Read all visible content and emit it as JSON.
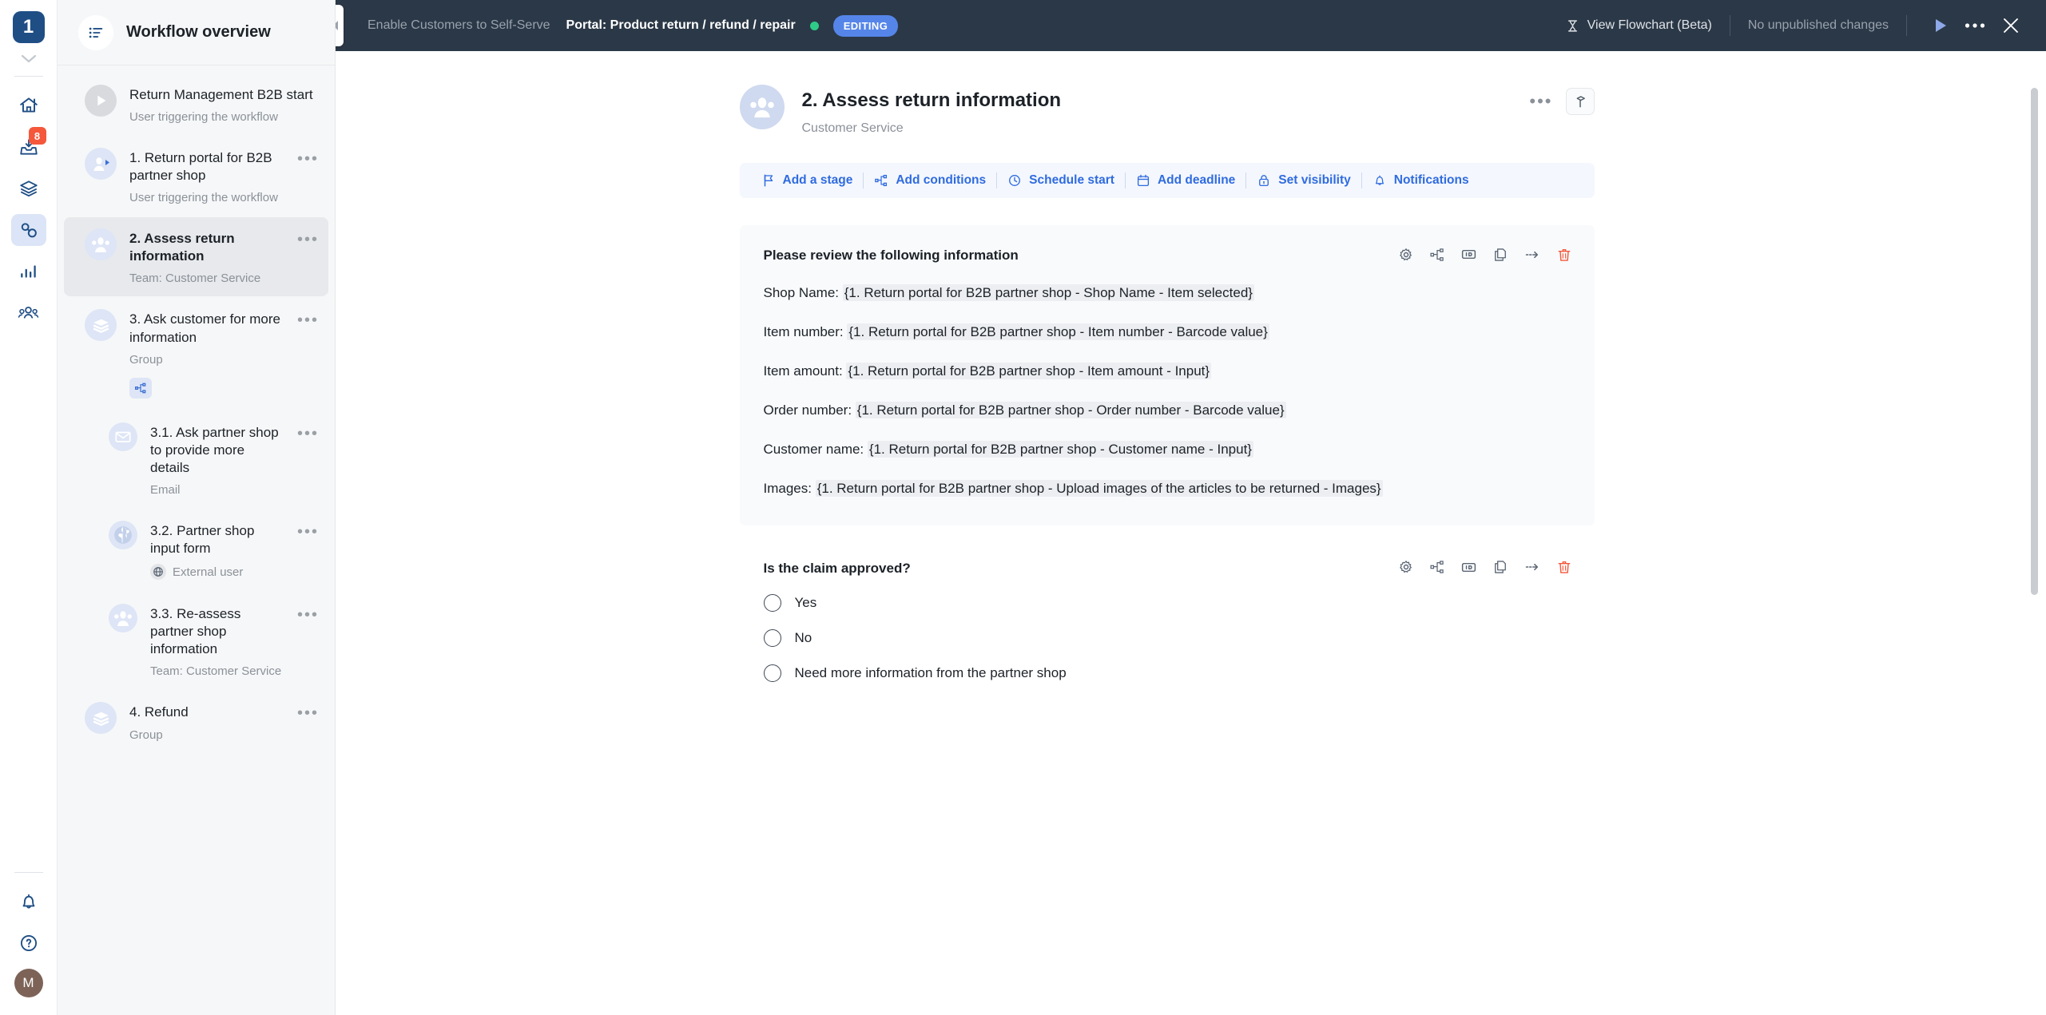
{
  "rail": {
    "logo_label": "1",
    "inbox_badge": "8",
    "avatar_initial": "M",
    "items": [
      {
        "name": "home",
        "icon": "home-icon"
      },
      {
        "name": "inbox",
        "icon": "inbox-icon",
        "badge": "8"
      },
      {
        "name": "layers",
        "icon": "layers-icon"
      },
      {
        "name": "workflows",
        "icon": "workflows-icon",
        "active": true
      },
      {
        "name": "reports",
        "icon": "bar-chart-icon"
      },
      {
        "name": "people",
        "icon": "people-icon"
      }
    ],
    "bottom_items": [
      {
        "name": "notifications",
        "icon": "bell-icon"
      },
      {
        "name": "help",
        "icon": "question-circle-icon"
      }
    ]
  },
  "sidebar": {
    "header_title": "Workflow overview",
    "header_icon": "list-icon",
    "items": [
      {
        "title": "Return Management B2B start",
        "subtitle": "User triggering the workflow",
        "icon": "play-circle-icon",
        "icon_style": "grey",
        "indent": false,
        "selected": false,
        "has_dots": false,
        "title_plain": true
      },
      {
        "title": "1. Return portal for B2B partner shop",
        "subtitle": "User triggering the workflow",
        "icon": "user-play-icon",
        "icon_style": "blue",
        "indent": false,
        "selected": false,
        "has_dots": true,
        "title_plain": true
      },
      {
        "title": "2. Assess return information",
        "subtitle": "Team: Customer Service",
        "icon": "users-icon",
        "icon_style": "blue",
        "indent": false,
        "selected": true,
        "has_dots": true,
        "title_plain": false
      },
      {
        "title": "3. Ask customer for more information",
        "subtitle": "Group",
        "icon": "layers-icon",
        "icon_style": "blue",
        "indent": false,
        "selected": false,
        "has_dots": true,
        "title_plain": true,
        "condition_chip": true
      },
      {
        "title": "3.1. Ask partner shop to provide more details",
        "subtitle": "Email",
        "icon": "envelope-icon",
        "icon_style": "blue",
        "indent": true,
        "selected": false,
        "has_dots": true,
        "title_plain": true
      },
      {
        "title": "3.2. Partner shop input form",
        "subtitle": "External user",
        "icon": "globe-icon",
        "icon_style": "blue",
        "indent": true,
        "selected": false,
        "has_dots": true,
        "title_plain": true,
        "sub_icon": "globe-small-icon"
      },
      {
        "title": "3.3. Re-assess partner shop information",
        "subtitle": "Team: Customer Service",
        "icon": "users-icon",
        "icon_style": "blue",
        "indent": true,
        "selected": false,
        "has_dots": true,
        "title_plain": true
      },
      {
        "title": "4. Refund",
        "subtitle": "Group",
        "icon": "layers-icon",
        "icon_style": "blue",
        "indent": false,
        "selected": false,
        "has_dots": true,
        "title_plain": true
      }
    ],
    "dots_label": "•••"
  },
  "topbar": {
    "breadcrumb_muted": "Enable Customers to Self-Serve",
    "breadcrumb_main": "Portal: Product return / refund / repair",
    "status_badge": "EDITING",
    "status_dot_color": "#2ecc87",
    "badge_color": "#5585e8",
    "flowchart_label": "View Flowchart (Beta)",
    "publish_status": "No unpublished changes",
    "run_icon": "play-icon",
    "more_icon": "ellipsis-icon",
    "close_icon": "close-icon",
    "collapse_icon": "chevron-left-icon"
  },
  "task": {
    "title": "2. Assess return information",
    "subtitle": "Customer Service",
    "avatar_icon": "users-icon",
    "more_label": "•••",
    "hammer_icon": "hammer-icon",
    "toolbar": [
      {
        "label": "Add a stage",
        "icon": "flag-icon"
      },
      {
        "label": "Add conditions",
        "icon": "conditions-icon"
      },
      {
        "label": "Schedule start",
        "icon": "clock-icon"
      },
      {
        "label": "Add deadline",
        "icon": "calendar-icon"
      },
      {
        "label": "Set visibility",
        "icon": "lock-icon"
      },
      {
        "label": "Notifications",
        "icon": "bell-icon"
      }
    ]
  },
  "cards": [
    {
      "title": "Please review the following information",
      "actions": [
        "gear-icon",
        "conditions-icon",
        "id-icon",
        "copy-icon",
        "move-arrow-icon",
        "trash-icon"
      ],
      "fields": [
        {
          "label": "Shop Name: ",
          "token": "{1. Return portal for B2B partner shop - Shop Name - Item selected}"
        },
        {
          "label": "Item number: ",
          "token": "{1. Return portal for B2B partner shop - Item number - Barcode value}"
        },
        {
          "label": "Item amount: ",
          "token": "{1. Return portal for B2B partner shop - Item amount - Input}"
        },
        {
          "label": "Order number: ",
          "token": "{1. Return portal for B2B partner shop - Order number - Barcode value}"
        },
        {
          "label": "Customer name: ",
          "token": "{1. Return portal for B2B partner shop - Customer name - Input}"
        },
        {
          "label": "Images: ",
          "token": "{1. Return portal for B2B partner shop - Upload images of the articles to be returned - Images}"
        }
      ]
    }
  ],
  "question": {
    "title": "Is the claim approved?",
    "actions": [
      "gear-icon",
      "conditions-icon",
      "id-icon",
      "copy-icon",
      "move-arrow-icon",
      "trash-icon"
    ],
    "options": [
      "Yes",
      "No",
      "Need more information from the partner shop"
    ]
  }
}
